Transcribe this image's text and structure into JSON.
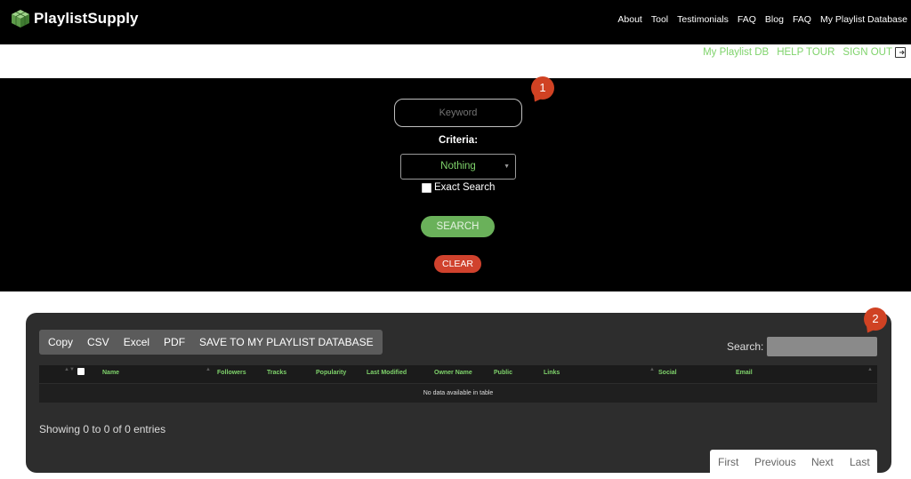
{
  "app": {
    "brand": "PlaylistSupply",
    "nav": [
      "About",
      "Tool",
      "Testimonials",
      "FAQ",
      "Blog",
      "FAQ",
      "My Playlist Database"
    ]
  },
  "sublinks": {
    "playlist_db": "My Playlist DB",
    "help_tour": "HELP TOUR",
    "sign_out": "SIGN OUT"
  },
  "search_form": {
    "keyword_placeholder": "Keyword",
    "criteria_label": "Criteria:",
    "criteria_value": "Nothing",
    "exact_search_label": "Exact Search",
    "search_button": "SEARCH",
    "clear_button": "CLEAR"
  },
  "markers": [
    "1",
    "2"
  ],
  "table": {
    "export_buttons": [
      "Copy",
      "CSV",
      "Excel",
      "PDF",
      "SAVE TO MY PLAYLIST DATABASE"
    ],
    "search_label": "Search:",
    "columns": [
      "Name",
      "Followers",
      "Tracks",
      "Popularity",
      "Last Modified",
      "Owner Name",
      "Public",
      "Links",
      "Social",
      "Email"
    ],
    "empty_message": "No data available in table",
    "info": "Showing 0 to 0 of 0 entries",
    "pagination": [
      "First",
      "Previous",
      "Next",
      "Last"
    ]
  },
  "colors": {
    "accent_green": "#7fd36b",
    "search_green": "#6ab15a",
    "clear_red": "#d0422d",
    "marker_red": "#d04223"
  }
}
